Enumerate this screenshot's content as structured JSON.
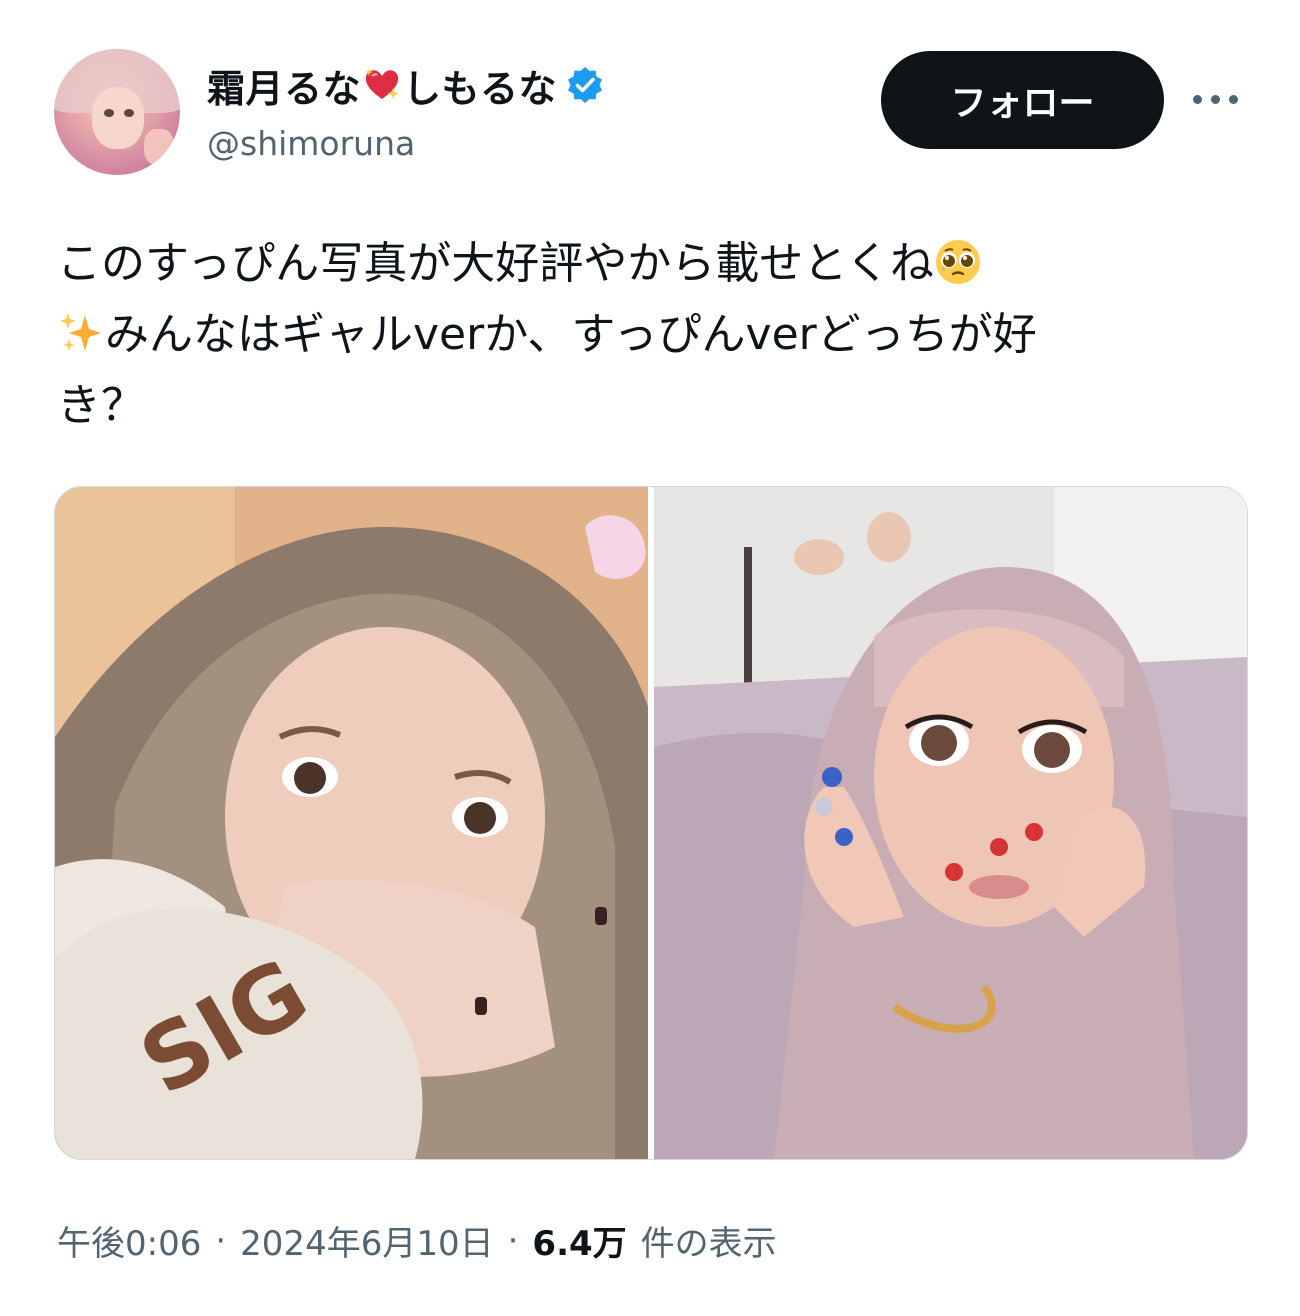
{
  "author": {
    "display_name_part1": "霜月るな",
    "display_name_part2": "しもるな",
    "handle": "@shimoruna",
    "verified": true,
    "verified_color": "#1d9bf0"
  },
  "actions": {
    "follow_label": "フォロー"
  },
  "tweet": {
    "text_line1": "このすっぴん写真が大好評やから載せとくね",
    "text_line2": "みんなはギャルverか、すっぴんverどっちが好",
    "text_line3": "き？"
  },
  "meta": {
    "time": "午後0:06",
    "date": "2024年6月10日",
    "views_count": "6.4万",
    "views_label": "件の表示",
    "separator": "·"
  },
  "colors": {
    "text": "#0f1419",
    "secondary": "#536471",
    "button_bg": "#0f1419"
  }
}
